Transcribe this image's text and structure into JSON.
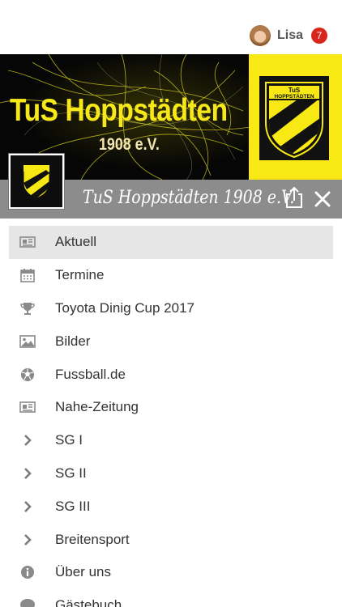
{
  "header": {
    "user_name": "Lisa",
    "notification_count": "7"
  },
  "banner": {
    "title": "TuS Hoppstädten",
    "subtitle": "1908 e.V.",
    "crest_text_top": "TuS",
    "crest_text_bottom": "HOPPSTÄDTEN"
  },
  "title_bar": {
    "club_title": "TuS Hoppstädten 1908 e.V."
  },
  "menu": {
    "items": [
      {
        "label": "Aktuell",
        "icon": "newspaper-icon",
        "active": true
      },
      {
        "label": "Termine",
        "icon": "calendar-icon",
        "active": false
      },
      {
        "label": "Toyota Dinig Cup 2017",
        "icon": "trophy-icon",
        "active": false
      },
      {
        "label": "Bilder",
        "icon": "image-icon",
        "active": false
      },
      {
        "label": "Fussball.de",
        "icon": "soccer-ball-icon",
        "active": false
      },
      {
        "label": "Nahe-Zeitung",
        "icon": "newspaper-icon",
        "active": false
      },
      {
        "label": "SG I",
        "icon": "chevron-right-icon",
        "active": false
      },
      {
        "label": "SG II",
        "icon": "chevron-right-icon",
        "active": false
      },
      {
        "label": "SG III",
        "icon": "chevron-right-icon",
        "active": false
      },
      {
        "label": "Breitensport",
        "icon": "chevron-right-icon",
        "active": false
      },
      {
        "label": "Über uns",
        "icon": "info-icon",
        "active": false
      },
      {
        "label": "Gästebuch",
        "icon": "chat-bubble-icon",
        "active": false
      }
    ]
  },
  "colors": {
    "brand_yellow": "#f8e914",
    "badge_red": "#d9261c",
    "title_bar_grey": "#8c8c8c",
    "active_row": "#e6e6e6",
    "icon_grey": "#8a8a8a"
  }
}
